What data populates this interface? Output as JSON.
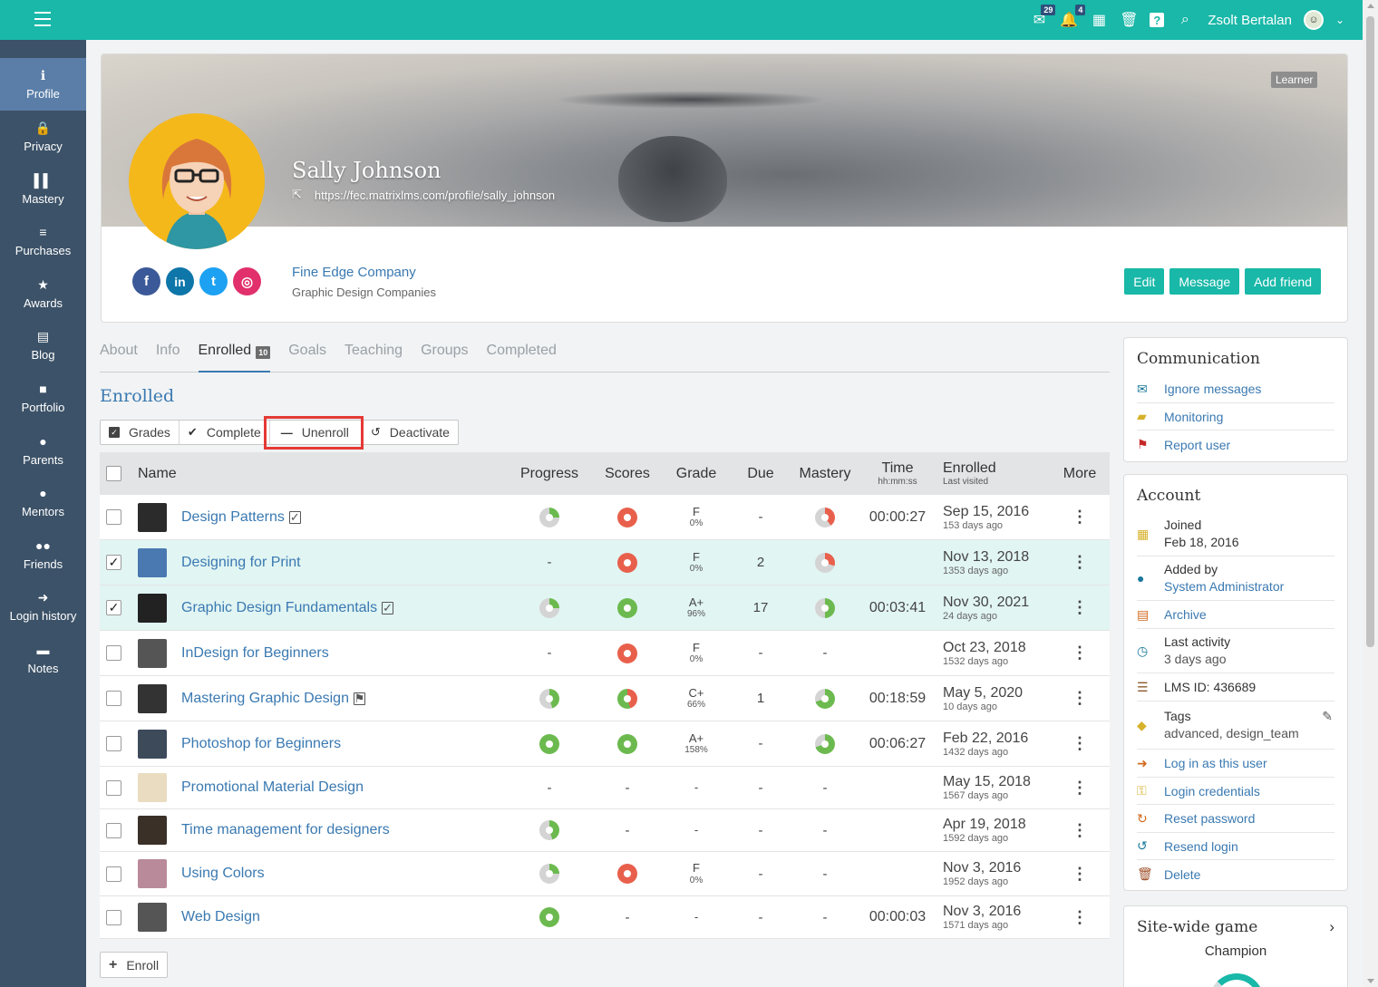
{
  "topbar": {
    "messages_badge": "29",
    "notifications_badge": "4",
    "user_name": "Zsolt Bertalan"
  },
  "sidebar": {
    "items": [
      {
        "label": "Profile",
        "icon": "info-icon",
        "glyph": "ℹ"
      },
      {
        "label": "Privacy",
        "icon": "lock-icon",
        "glyph": "🔒"
      },
      {
        "label": "Mastery",
        "icon": "bar-chart-icon",
        "glyph": "▌▌"
      },
      {
        "label": "Purchases",
        "icon": "coins-icon",
        "glyph": "≡"
      },
      {
        "label": "Awards",
        "icon": "star-icon",
        "glyph": "★"
      },
      {
        "label": "Blog",
        "icon": "blog-icon",
        "glyph": "▤"
      },
      {
        "label": "Portfolio",
        "icon": "folder-icon",
        "glyph": "■"
      },
      {
        "label": "Parents",
        "icon": "user-icon",
        "glyph": "●"
      },
      {
        "label": "Mentors",
        "icon": "user-icon",
        "glyph": "●"
      },
      {
        "label": "Friends",
        "icon": "users-icon",
        "glyph": "●●"
      },
      {
        "label": "Login history",
        "icon": "arrow-right-icon",
        "glyph": "➜"
      },
      {
        "label": "Notes",
        "icon": "note-icon",
        "glyph": "▬"
      }
    ]
  },
  "profile": {
    "role_badge": "Learner",
    "name": "Sally Johnson",
    "url": "https://fec.matrixlms.com/profile/sally_johnson",
    "company": "Fine Edge Company",
    "company_group": "Graphic Design Companies",
    "buttons": {
      "edit": "Edit",
      "message": "Message",
      "add_friend": "Add friend"
    },
    "socials": [
      {
        "name": "facebook-icon",
        "glyph": "f",
        "color": "#3b5998"
      },
      {
        "name": "linkedin-icon",
        "glyph": "in",
        "color": "#0e76a8"
      },
      {
        "name": "twitter-icon",
        "glyph": "t",
        "color": "#1da1f2"
      },
      {
        "name": "instagram-icon",
        "glyph": "◎",
        "color": "#e1306c"
      }
    ]
  },
  "tabs": {
    "about": "About",
    "info": "Info",
    "enrolled": "Enrolled",
    "enrolled_count": "10",
    "goals": "Goals",
    "teaching": "Teaching",
    "groups": "Groups",
    "completed": "Completed"
  },
  "section_title": "Enrolled",
  "actions": {
    "grades": "Grades",
    "complete": "Complete",
    "unenroll": "Unenroll",
    "deactivate": "Deactivate"
  },
  "table": {
    "headers": {
      "name": "Name",
      "progress": "Progress",
      "scores": "Scores",
      "grade": "Grade",
      "due": "Due",
      "mastery": "Mastery",
      "time": "Time",
      "time_sub": "hh:mm:ss",
      "enrolled": "Enrolled",
      "enrolled_sub": "Last visited",
      "more": "More"
    },
    "rows": [
      {
        "name": "Design Patterns",
        "suffix": "✓",
        "checked": false,
        "progress": "pie-green-low",
        "scores": "red",
        "grade": "F",
        "grade_pct": "0%",
        "due": "-",
        "mastery": "pie-red",
        "time": "00:00:27",
        "enrolled": "Sep 15, 2016",
        "last_visited": "153 days ago",
        "thumb": "#2b2b2b"
      },
      {
        "name": "Designing for Print",
        "suffix": "",
        "checked": true,
        "progress": "-",
        "scores": "red",
        "grade": "F",
        "grade_pct": "0%",
        "due": "2",
        "mastery": "pie-red-small",
        "time": "",
        "enrolled": "Nov 13, 2018",
        "last_visited": "1353 days ago",
        "thumb": "#4a78b0"
      },
      {
        "name": "Graphic Design Fundamentals",
        "suffix": "✓",
        "checked": true,
        "progress": "pie-green-low",
        "scores": "green",
        "grade": "A+",
        "grade_pct": "96%",
        "due": "17",
        "mastery": "pie-green-half",
        "time": "00:03:41",
        "enrolled": "Nov 30, 2021",
        "last_visited": "24 days ago",
        "thumb": "#222"
      },
      {
        "name": "InDesign for Beginners",
        "suffix": "",
        "checked": false,
        "progress": "-",
        "scores": "red",
        "grade": "F",
        "grade_pct": "0%",
        "due": "-",
        "mastery": "-",
        "time": "",
        "enrolled": "Oct 23, 2018",
        "last_visited": "1532 days ago",
        "thumb": "#555"
      },
      {
        "name": "Mastering Graphic Design",
        "suffix": "⚑",
        "checked": false,
        "progress": "pie-green-mid",
        "scores": "pie-mixed",
        "grade": "C+",
        "grade_pct": "66%",
        "due": "1",
        "mastery": "pie-green-most",
        "time": "00:18:59",
        "enrolled": "May 5, 2020",
        "last_visited": "10 days ago",
        "thumb": "#333"
      },
      {
        "name": "Photoshop for Beginners",
        "suffix": "",
        "checked": false,
        "progress": "green",
        "scores": "green",
        "grade": "A+",
        "grade_pct": "158%",
        "due": "-",
        "mastery": "pie-green-most",
        "time": "00:06:27",
        "enrolled": "Feb 22, 2016",
        "last_visited": "1432 days ago",
        "thumb": "#3d4a5a"
      },
      {
        "name": "Promotional Material Design",
        "suffix": "",
        "checked": false,
        "progress": "-",
        "scores": "-",
        "grade": "-",
        "grade_pct": "",
        "due": "-",
        "mastery": "-",
        "time": "",
        "enrolled": "May 15, 2018",
        "last_visited": "1567 days ago",
        "thumb": "#e9dcc0"
      },
      {
        "name": "Time management for designers",
        "suffix": "",
        "checked": false,
        "progress": "pie-green-mid",
        "scores": "-",
        "grade": "-",
        "grade_pct": "",
        "due": "-",
        "mastery": "-",
        "time": "",
        "enrolled": "Apr 19, 2018",
        "last_visited": "1592 days ago",
        "thumb": "#3a3028"
      },
      {
        "name": "Using Colors",
        "suffix": "",
        "checked": false,
        "progress": "pie-green-low",
        "scores": "red",
        "grade": "F",
        "grade_pct": "0%",
        "due": "-",
        "mastery": "-",
        "time": "",
        "enrolled": "Nov 3, 2016",
        "last_visited": "1952 days ago",
        "thumb": "#b98a9a"
      },
      {
        "name": "Web Design",
        "suffix": "",
        "checked": false,
        "progress": "green",
        "scores": "-",
        "grade": "-",
        "grade_pct": "",
        "due": "-",
        "mastery": "-",
        "time": "00:00:03",
        "enrolled": "Nov 3, 2016",
        "last_visited": "1571 days ago",
        "thumb": "#555"
      }
    ]
  },
  "enroll_button": "Enroll",
  "communication": {
    "title": "Communication",
    "items": [
      {
        "label": "Ignore messages",
        "icon": "envelope-x-icon",
        "glyph": "✉",
        "color": "#19789b"
      },
      {
        "label": "Monitoring",
        "icon": "chat-icon",
        "glyph": "▰",
        "color": "#d6b12b"
      },
      {
        "label": "Report user",
        "icon": "flag-icon",
        "glyph": "⚑",
        "color": "#c62828"
      }
    ]
  },
  "account": {
    "title": "Account",
    "joined_label": "Joined",
    "joined_value": "Feb 18, 2016",
    "added_by_label": "Added by",
    "added_by_value": "System Administrator",
    "archive": "Archive",
    "last_activity_label": "Last activity",
    "last_activity_value": "3 days ago",
    "lms_id": "LMS ID: 436689",
    "tags_label": "Tags",
    "tags_value": "advanced, design_team",
    "login_as": "Log in as this user",
    "login_credentials": "Login credentials",
    "reset_password": "Reset password",
    "resend_login": "Resend login",
    "delete": "Delete"
  },
  "site_game": {
    "title": "Site-wide game",
    "subtitle": "Champion"
  }
}
